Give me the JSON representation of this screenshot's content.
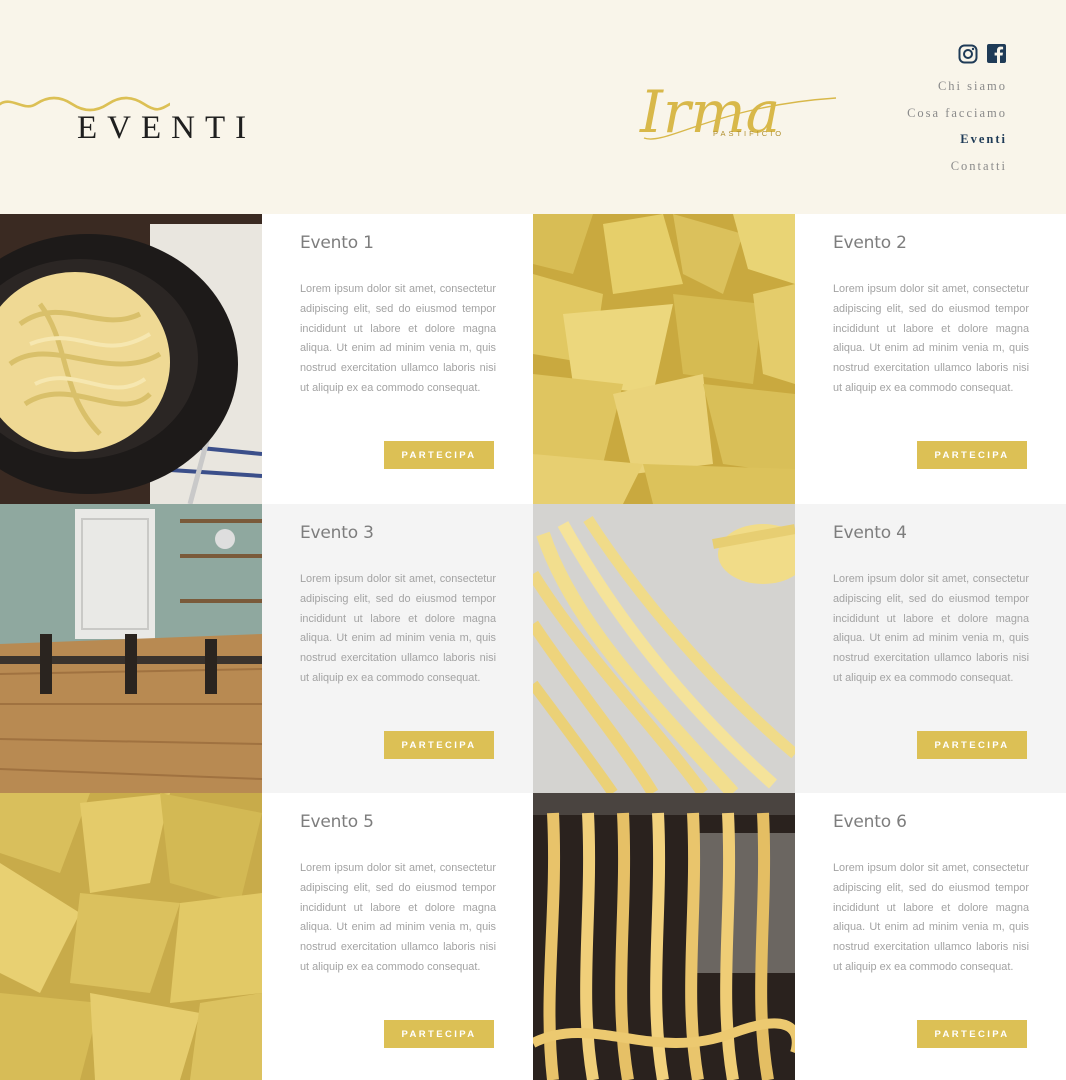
{
  "header": {
    "page_title": "EVENTI",
    "logo": {
      "script": "Irma",
      "subtitle": "PASTIFICIO"
    },
    "social": [
      {
        "icon": "instagram-icon"
      },
      {
        "icon": "facebook-icon"
      }
    ],
    "nav": [
      {
        "label": "Chi siamo",
        "active": false
      },
      {
        "label": "Cosa facciamo",
        "active": false
      },
      {
        "label": "Eventi",
        "active": true
      },
      {
        "label": "Contatti",
        "active": false
      }
    ]
  },
  "colors": {
    "background": "#f9f5ea",
    "accent": "#dcc055",
    "nav_active": "#1f3b57",
    "card_white": "#ffffff",
    "card_grey": "#f4f4f4"
  },
  "events": [
    {
      "title": "Evento 1",
      "text": "Lorem ipsum dolor sit amet, consectetur adipiscing elit, sed do eiusmod tempor incididunt ut labore et dolore magna aliqua. Ut enim ad minim venia m, quis nostrud exercitation ullamco laboris nisi ut aliquip ex ea commodo consequat.",
      "button": "PARTECIPA",
      "image": "tagliatelle-in-bowl"
    },
    {
      "title": "Evento 2",
      "text": "Lorem ipsum dolor sit amet, consectetur adipiscing elit, sed do eiusmod tempor incididunt ut labore et dolore magna aliqua. Ut enim ad minim venia m, quis nostrud exercitation ullamco laboris nisi ut aliquip ex ea commodo consequat.",
      "button": "PARTECIPA",
      "image": "maltagliati-pasta"
    },
    {
      "title": "Evento 3",
      "text": "Lorem ipsum dolor sit amet, consectetur adipiscing elit, sed do eiusmod tempor incididunt ut labore et dolore magna aliqua. Ut enim ad minim venia m, quis nostrud exercitation ullamco laboris nisi ut aliquip ex ea commodo consequat.",
      "button": "PARTECIPA",
      "image": "pasta-workshop-kitchen"
    },
    {
      "title": "Evento 4",
      "text": "Lorem ipsum dolor sit amet, consectetur adipiscing elit, sed do eiusmod tempor incididunt ut labore et dolore magna aliqua. Ut enim ad minim venia m, quis nostrud exercitation ullamco laboris nisi ut aliquip ex ea commodo consequat.",
      "button": "PARTECIPA",
      "image": "fresh-cut-tagliatelle"
    },
    {
      "title": "Evento 5",
      "text": "Lorem ipsum dolor sit amet, consectetur adipiscing elit, sed do eiusmod tempor incididunt ut labore et dolore magna aliqua. Ut enim ad minim venia m, quis nostrud exercitation ullamco laboris nisi ut aliquip ex ea commodo consequat.",
      "button": "PARTECIPA",
      "image": "pappardelle-triangles"
    },
    {
      "title": "Evento 6",
      "text": "Lorem ipsum dolor sit amet, consectetur adipiscing elit, sed do eiusmod tempor incididunt ut labore et dolore magna aliqua. Ut enim ad minim venia m, quis nostrud exercitation ullamco laboris nisi ut aliquip ex ea commodo consequat.",
      "button": "PARTECIPA",
      "image": "pasta-machine-ribbons"
    }
  ]
}
